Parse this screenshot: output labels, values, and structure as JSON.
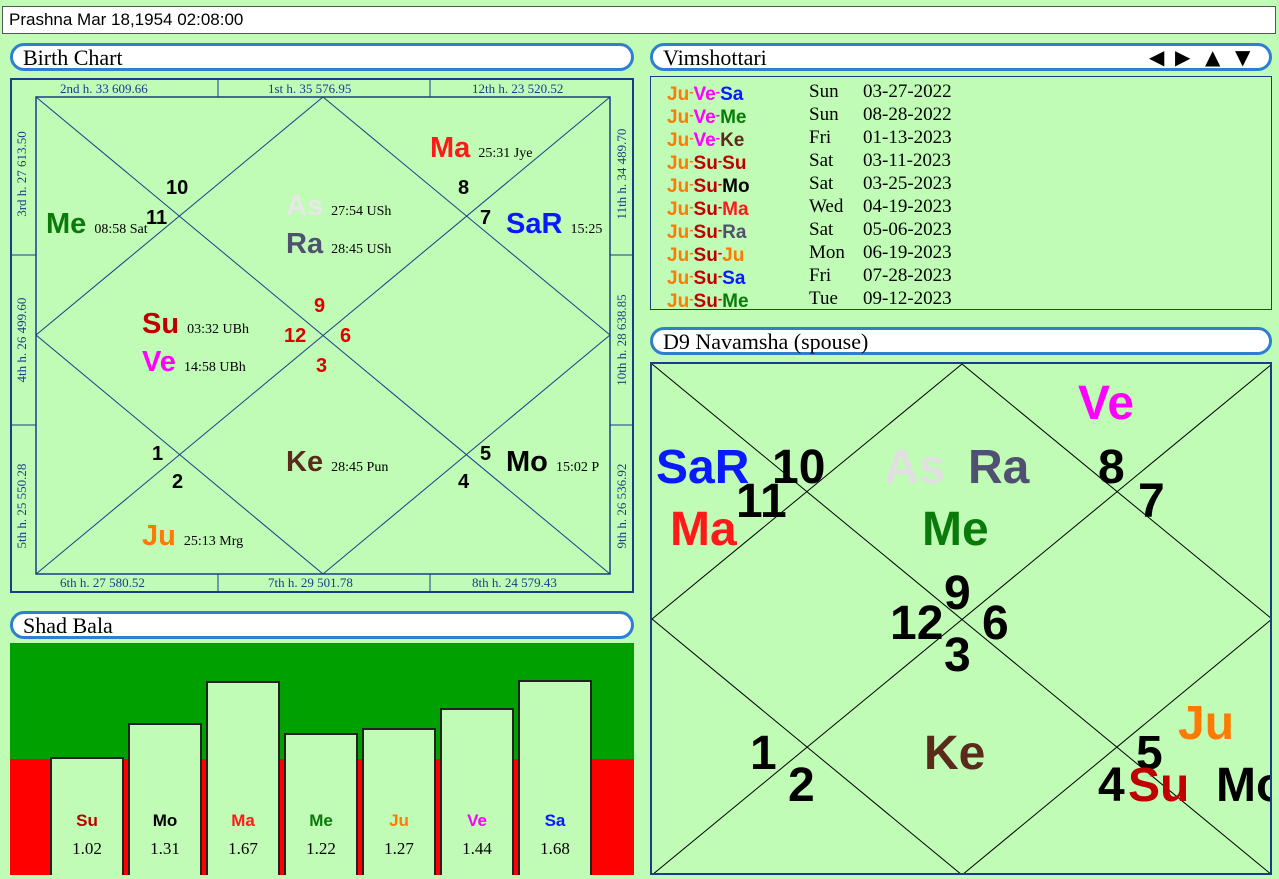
{
  "titlebar": {
    "text": "Prashna   Mar 18,1954 02:08:00"
  },
  "birth_chart": {
    "title": "Birth Chart",
    "top_edges": [
      "2nd h.  33  609.66",
      "1st h.  35  576.95",
      "12th h.  23  520.52"
    ],
    "bottom_edges": [
      "6th h.  27  580.52",
      "7th h.  29  501.78",
      "8th h.  24  579.43"
    ],
    "left_edges": [
      "3rd h.  27  613.50",
      "4th h.  26  499.60",
      "5th h.  25  550.28"
    ],
    "right_edges": [
      "11th h.  34  489.70",
      "10th h.  28  638.85",
      "9th h.  26  536.92"
    ],
    "house_numbers": [
      "10",
      "11",
      "8",
      "7",
      "9",
      "12",
      "6",
      "3",
      "1",
      "2",
      "5",
      "4"
    ],
    "planets": [
      {
        "name": "Ma",
        "deg": "25:31  Jye",
        "color": "#ff1a1a"
      },
      {
        "name": "Me",
        "deg": "08:58  Sat",
        "color": "#0a7a0a"
      },
      {
        "name": "As",
        "deg": "27:54  USh",
        "color": "#e8e8e8"
      },
      {
        "name": "Ra",
        "deg": "28:45  USh",
        "color": "#505070"
      },
      {
        "name": "SaR",
        "deg": "15:25",
        "color": "#0a1aff"
      },
      {
        "name": "Su",
        "deg": "03:32  UBh",
        "color": "#c00000"
      },
      {
        "name": "Ve",
        "deg": "14:58  UBh",
        "color": "#ff00ff"
      },
      {
        "name": "Ke",
        "deg": "28:45  Pun",
        "color": "#5a2a1a"
      },
      {
        "name": "Mo",
        "deg": "15:02  P",
        "color": "#000000"
      },
      {
        "name": "Ju",
        "deg": "25:13  Mrg",
        "color": "#ff7a00"
      }
    ]
  },
  "vimshottari": {
    "title": "Vimshottari",
    "nav_icons": [
      "triangle-left-icon",
      "triangle-right-icon",
      "triangle-up-icon",
      "triangle-down-icon"
    ],
    "rows": [
      {
        "p": [
          "Ju",
          "Ve",
          "Sa"
        ],
        "day": "Sun",
        "date": "03-27-2022"
      },
      {
        "p": [
          "Ju",
          "Ve",
          "Me"
        ],
        "day": "Sun",
        "date": "08-28-2022"
      },
      {
        "p": [
          "Ju",
          "Ve",
          "Ke"
        ],
        "day": "Fri",
        "date": "01-13-2023"
      },
      {
        "p": [
          "Ju",
          "Su",
          "Su"
        ],
        "day": "Sat",
        "date": "03-11-2023"
      },
      {
        "p": [
          "Ju",
          "Su",
          "Mo"
        ],
        "day": "Sat",
        "date": "03-25-2023"
      },
      {
        "p": [
          "Ju",
          "Su",
          "Ma"
        ],
        "day": "Wed",
        "date": "04-19-2023"
      },
      {
        "p": [
          "Ju",
          "Su",
          "Ra"
        ],
        "day": "Sat",
        "date": "05-06-2023"
      },
      {
        "p": [
          "Ju",
          "Su",
          "Ju"
        ],
        "day": "Mon",
        "date": "06-19-2023"
      },
      {
        "p": [
          "Ju",
          "Su",
          "Sa"
        ],
        "day": "Fri",
        "date": "07-28-2023"
      },
      {
        "p": [
          "Ju",
          "Su",
          "Me"
        ],
        "day": "Tue",
        "date": "09-12-2023"
      }
    ],
    "colors": {
      "Ju": "#ff7a00",
      "Ve": "#ff00ff",
      "Sa": "#0a1aff",
      "Me": "#0a7a0a",
      "Ke": "#5a2a1a",
      "Su": "#c00000",
      "Mo": "#000000",
      "Ma": "#ff1a1a",
      "Ra": "#505070"
    }
  },
  "navamsha": {
    "title": "D9 Navamsha  (spouse)",
    "house_numbers": [
      "10",
      "11",
      "8",
      "7",
      "9",
      "12",
      "6",
      "3",
      "1",
      "2",
      "5",
      "4"
    ],
    "planets": [
      {
        "name": "Ve",
        "color": "#ff00ff"
      },
      {
        "name": "SaR",
        "color": "#0a1aff"
      },
      {
        "name": "As",
        "color": "#e0e0e0"
      },
      {
        "name": "Ra",
        "color": "#505070"
      },
      {
        "name": "Ma",
        "color": "#ff1a1a"
      },
      {
        "name": "Me",
        "color": "#0a7a0a"
      },
      {
        "name": "Ke",
        "color": "#5a2a1a"
      },
      {
        "name": "Ju",
        "color": "#ff7a00"
      },
      {
        "name": "Su",
        "color": "#c00000"
      },
      {
        "name": "Mo",
        "color": "#000000"
      }
    ]
  },
  "shad_bala": {
    "title": "Shad Bala",
    "chart_data": {
      "type": "bar",
      "categories": [
        "Su",
        "Mo",
        "Ma",
        "Me",
        "Ju",
        "Ve",
        "Sa"
      ],
      "values": [
        1.02,
        1.31,
        1.67,
        1.22,
        1.27,
        1.44,
        1.68
      ],
      "value_labels": [
        "1.02",
        "1.31",
        "1.67",
        "1.22",
        "1.27",
        "1.44",
        "1.68"
      ],
      "colors": [
        "#c00000",
        "#000000",
        "#ff1a1a",
        "#0a7a0a",
        "#ff7a00",
        "#ff00ff",
        "#0a1aff"
      ],
      "background_bands": {
        "upper": "#00a000",
        "lower": "#ff0000"
      },
      "threshold": 1.0
    }
  }
}
